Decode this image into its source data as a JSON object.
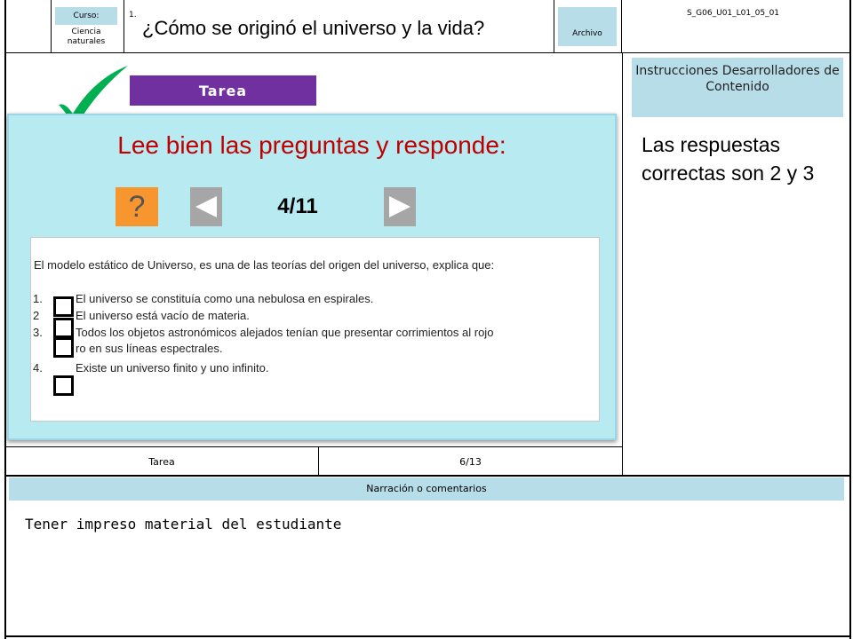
{
  "header": {
    "course_label": "Curso:",
    "course_value": "Ciencia naturales",
    "number": "1.",
    "title": "¿Cómo se originó el universo y la vida?",
    "file_label": "Archivo",
    "code": "S_G06_U01_L01_05_01"
  },
  "activity": {
    "banner": "Tarea",
    "heading": "Lee bien las preguntas y responde:",
    "help_symbol": "?",
    "counter": "4/11",
    "question": "El modelo estático de Universo, es una de las teorías del origen del universo, explica que:",
    "options": [
      {
        "num": "1.",
        "text": "El universo se constituía como una nebulosa en espirales."
      },
      {
        "num": "2",
        "text": "El universo está vacío de materia."
      },
      {
        "num": "3.",
        "text": "Todos los objetos astronómicos alejados tenían que presentar corrimientos al   rojo"
      },
      {
        "num": "",
        "text": "ro en sus líneas espectrales."
      },
      {
        "num": "4.",
        "text": "Existe un universo finito y uno infinito."
      }
    ]
  },
  "sidebar": {
    "instructions": "Instrucciones Desarrolladores de Contenido",
    "answer": "Las respuestas correctas  son 2 y 3"
  },
  "footer_row": {
    "type": "Tarea",
    "page": "6/13"
  },
  "narration": {
    "label": "Narración o comentarios",
    "text": "Tener impreso material del estudiante"
  },
  "colors": {
    "accent_purple": "#7030a0",
    "heading_red": "#c00000",
    "panel_cyan": "#b8eaf1",
    "label_blue": "#b7dde8",
    "help_orange": "#f7962e",
    "check_green": "#00b050"
  },
  "icons": [
    "checkmark-icon",
    "question-icon",
    "arrow-left-icon",
    "arrow-right-icon",
    "checkbox-icon"
  ]
}
